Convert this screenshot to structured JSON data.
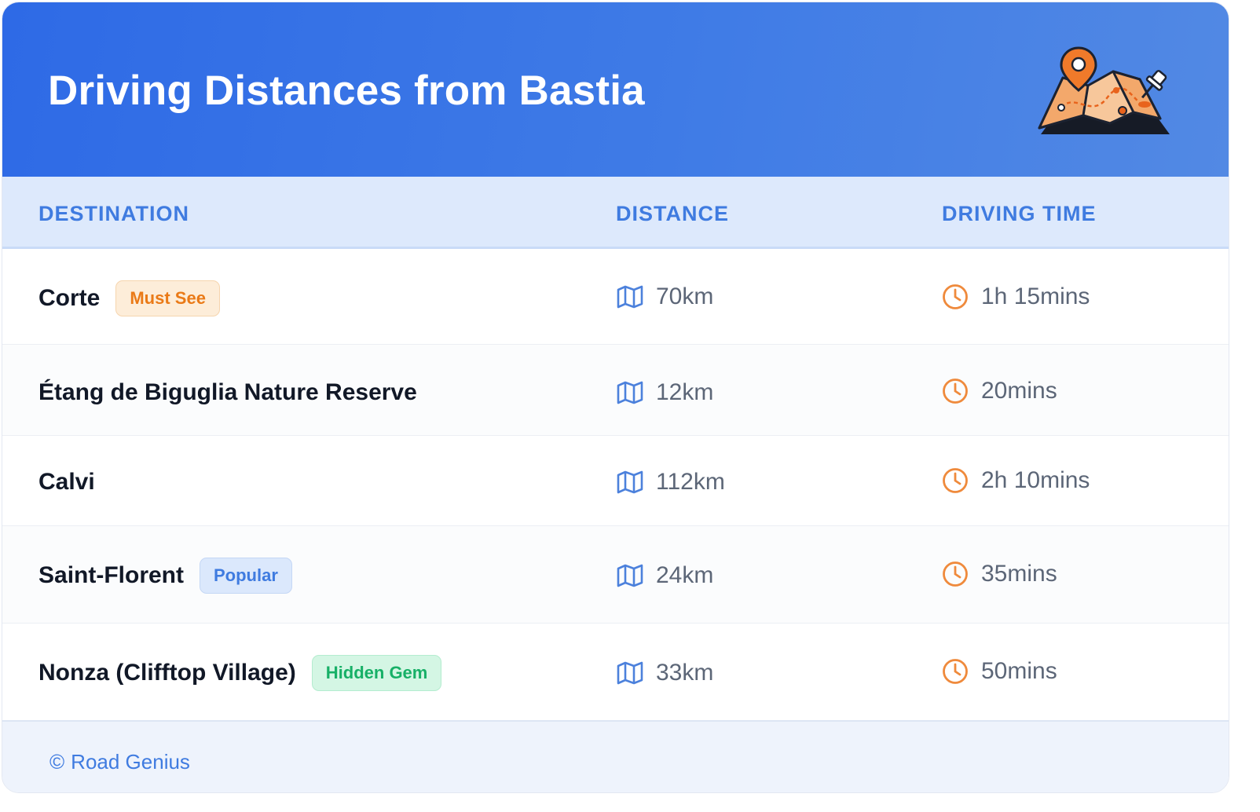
{
  "header": {
    "title": "Driving Distances from Bastia",
    "illustration": "map-with-pin-illustration"
  },
  "columns": {
    "destination": "DESTINATION",
    "distance": "DISTANCE",
    "driving_time": "DRIVING TIME"
  },
  "rows": [
    {
      "destination": "Corte",
      "badge": "Must See",
      "distance": "70km",
      "time": "1h 15mins"
    },
    {
      "destination": "Étang de Biguglia Nature Reserve",
      "badge": "",
      "distance": "12km",
      "time": "20mins"
    },
    {
      "destination": "Calvi",
      "badge": "",
      "distance": "112km",
      "time": "2h 10mins"
    },
    {
      "destination": "Saint-Florent",
      "badge": "Popular",
      "distance": "24km",
      "time": "35mins"
    },
    {
      "destination": "Nonza (Clifftop Village)",
      "badge": "Hidden Gem",
      "distance": "33km",
      "time": "50mins"
    }
  ],
  "icons": {
    "distance": "map-icon",
    "time": "clock-icon",
    "copyright": "copyright-icon"
  },
  "footer": {
    "copyright_symbol": "©",
    "brand": "Road Genius"
  },
  "colors": {
    "header_start": "#2e6ae6",
    "header_end": "#5289e4",
    "accent_blue": "#3f7be0",
    "accent_orange": "#ea7a17",
    "accent_green": "#17b067"
  }
}
